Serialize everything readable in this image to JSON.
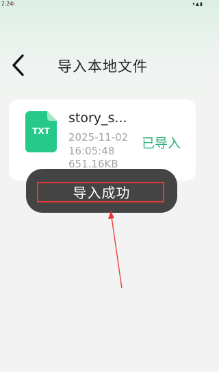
{
  "status_bar": {
    "time": "2:24",
    "mute_glyph": "⊘",
    "signal_icons": "▾▲▮"
  },
  "header": {
    "back_icon": "chevron-left-icon",
    "title": "导入本地文件"
  },
  "file": {
    "type_label": "TXT",
    "name": "story_s...",
    "date": "2025-11-02",
    "time": "16:05:48",
    "size": "651.16KB",
    "status": "已导入"
  },
  "toast": {
    "message": "导入成功"
  },
  "colors": {
    "accent_green": "#2db07b",
    "file_icon_green": "#27c98a",
    "annotation_red": "#e53935"
  }
}
